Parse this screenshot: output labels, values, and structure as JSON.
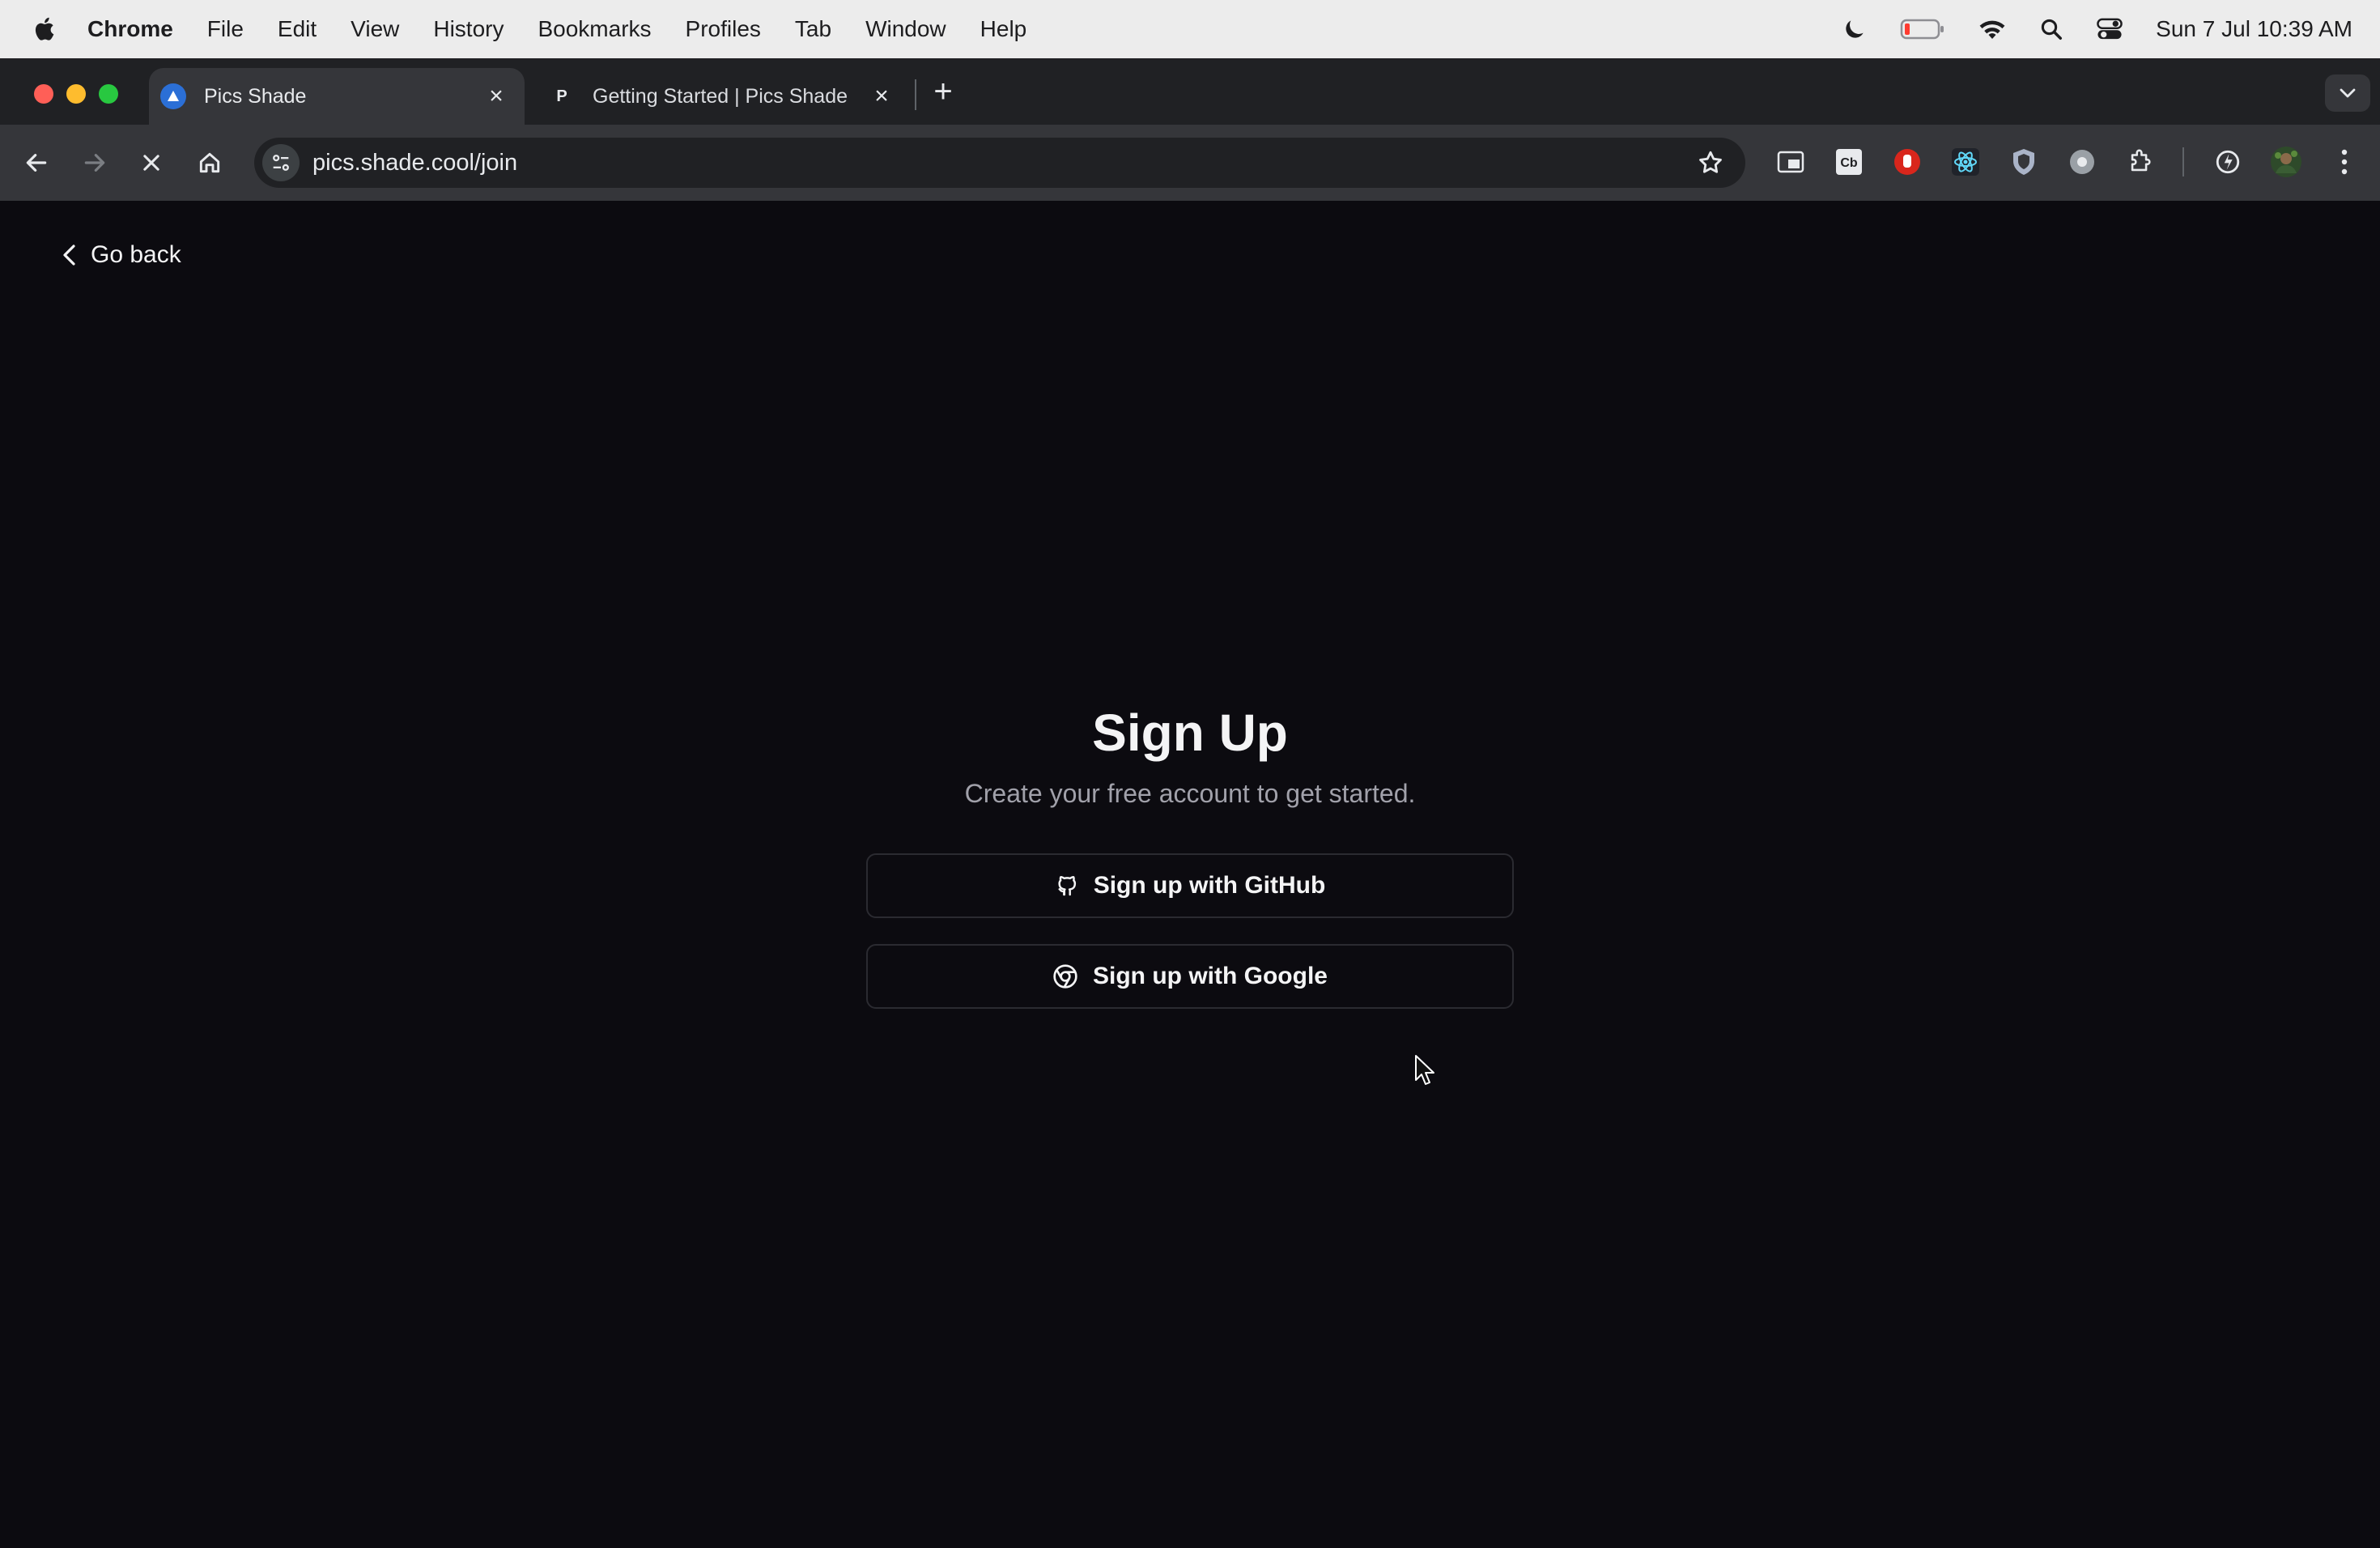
{
  "menubar": {
    "app_name": "Chrome",
    "items": [
      "File",
      "Edit",
      "View",
      "History",
      "Bookmarks",
      "Profiles",
      "Tab",
      "Window",
      "Help"
    ],
    "clock": "Sun 7 Jul  10:39 AM"
  },
  "tabs": [
    {
      "title": "Pics Shade",
      "favicon": "pics-shade-logo",
      "active": true
    },
    {
      "title": "Getting Started | Pics Shade",
      "favicon_letter": "P",
      "active": false
    }
  ],
  "toolbar": {
    "url": "pics.shade.cool/join"
  },
  "page": {
    "go_back_label": "Go back",
    "title": "Sign Up",
    "subtitle": "Create your free account to get started.",
    "github_button_label": "Sign up with GitHub",
    "google_button_label": "Sign up with Google"
  }
}
